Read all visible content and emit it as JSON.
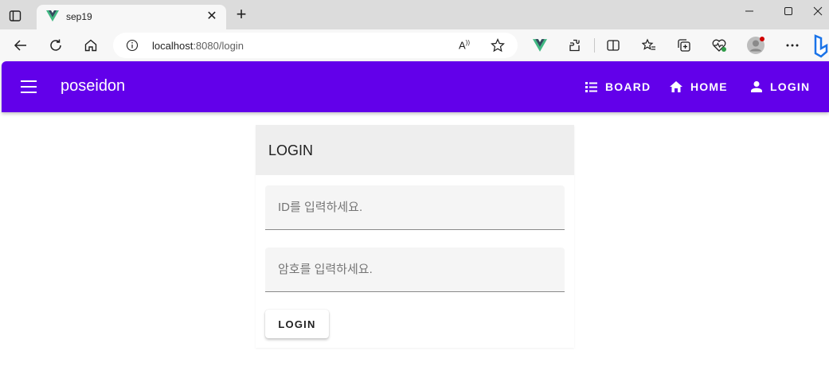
{
  "browser": {
    "tab": {
      "title": "sep19"
    },
    "address": {
      "host": "localhost",
      "rest": ":8080/login"
    }
  },
  "appbar": {
    "title": "poseidon",
    "nav": [
      {
        "label": "BOARD",
        "icon": "list-icon"
      },
      {
        "label": "HOME",
        "icon": "home-icon"
      },
      {
        "label": "LOGIN",
        "icon": "account-icon"
      }
    ],
    "color": "#6200ea"
  },
  "login_card": {
    "title": "LOGIN",
    "id_placeholder": "ID를 입력하세요.",
    "password_placeholder": "암호를 입력하세요.",
    "submit_label": "LOGIN"
  }
}
